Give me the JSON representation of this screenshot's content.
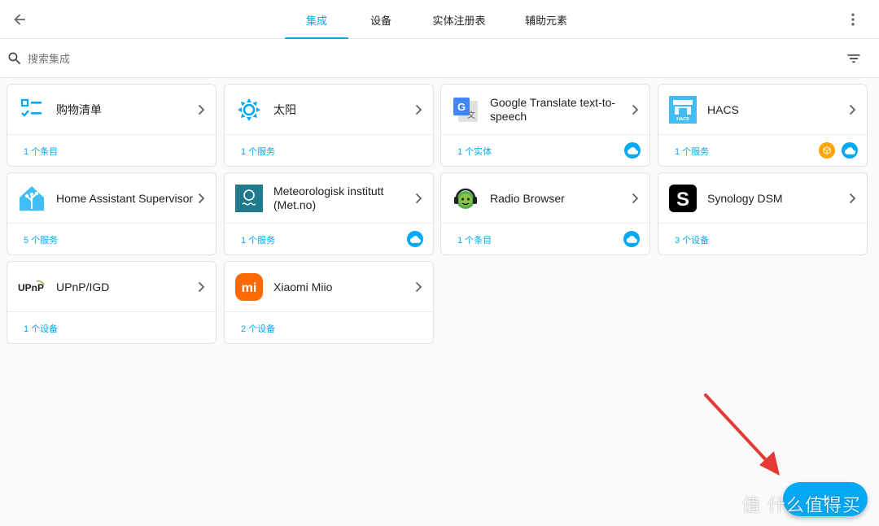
{
  "header": {
    "tabs": [
      {
        "label": "集成",
        "active": true
      },
      {
        "label": "设备",
        "active": false
      },
      {
        "label": "实体注册表",
        "active": false
      },
      {
        "label": "辅助元素",
        "active": false
      }
    ]
  },
  "search": {
    "placeholder": "搜索集成"
  },
  "cards": [
    {
      "title": "购物清单",
      "link": "1 个条目",
      "icon": "shopping-list-icon",
      "badges": []
    },
    {
      "title": "太阳",
      "link": "1 个服务",
      "icon": "sun-icon",
      "badges": []
    },
    {
      "title": "Google Translate text-to-speech",
      "link": "1 个实体",
      "icon": "google-translate-icon",
      "badges": [
        "cloud"
      ]
    },
    {
      "title": "HACS",
      "link": "1 个服务",
      "icon": "hacs-icon",
      "badges": [
        "custom",
        "cloud"
      ]
    },
    {
      "title": "Home Assistant Supervisor",
      "link": "5 个服务",
      "icon": "home-assistant-icon",
      "badges": []
    },
    {
      "title": "Meteorologisk institutt (Met.no)",
      "link": "1 个服务",
      "icon": "met-no-icon",
      "badges": [
        "cloud"
      ]
    },
    {
      "title": "Radio Browser",
      "link": "1 个条目",
      "icon": "radio-browser-icon",
      "badges": [
        "cloud"
      ]
    },
    {
      "title": "Synology DSM",
      "link": "3 个设备",
      "icon": "synology-icon",
      "badges": []
    },
    {
      "title": "UPnP/IGD",
      "link": "1 个设备",
      "icon": "upnp-icon",
      "badges": []
    },
    {
      "title": "Xiaomi Miio",
      "link": "2 个设备",
      "icon": "xiaomi-icon",
      "badges": []
    }
  ],
  "logos": {
    "hacs_text": "HACS",
    "upnp_text": "UPnP",
    "xiaomi_text": "mi",
    "synology_text": "S"
  },
  "watermark": "值 什么值得买",
  "colors": {
    "accent": "#03a9f4",
    "custom_badge": "#ffa600",
    "annotation_arrow": "#e53935"
  }
}
